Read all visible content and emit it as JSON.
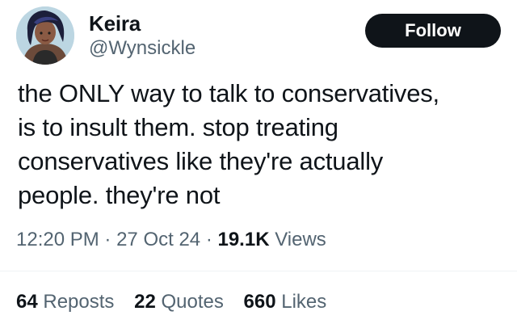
{
  "author": {
    "display_name": "Keira",
    "handle": "@Wynsickle",
    "avatar_icon": "profile-avatar"
  },
  "follow_label": "Follow",
  "tweet": {
    "lines": [
      "the ONLY way to talk to conservatives,",
      "is to insult them.  stop treating",
      "conservatives like they're actually",
      "people.  they're not"
    ]
  },
  "meta": {
    "time": "12:20 PM",
    "separator": "·",
    "date": "27 Oct 24",
    "views_count": "19.1K",
    "views_label": "Views"
  },
  "stats": {
    "reposts_count": "64",
    "reposts_label": "Reposts",
    "quotes_count": "22",
    "quotes_label": "Quotes",
    "likes_count": "660",
    "likes_label": "Likes"
  },
  "colors": {
    "text": "#0f1419",
    "secondary": "#536471",
    "button_bg": "#0f1419",
    "divider": "#eff3f4"
  }
}
